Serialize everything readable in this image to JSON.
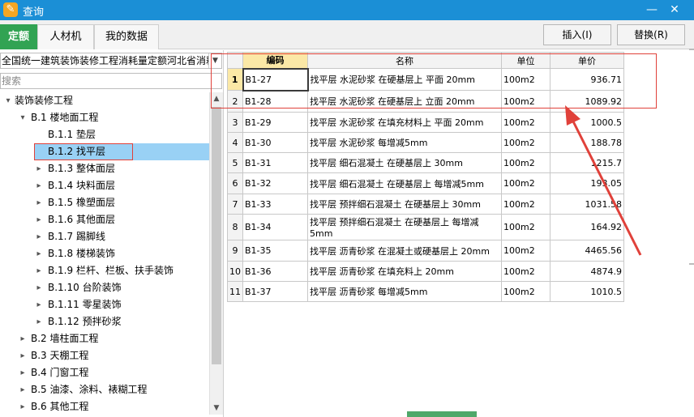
{
  "window": {
    "title": "查询",
    "minimize": "—",
    "close": "✕",
    "app_icon": "edit-icon"
  },
  "tabs": [
    "定额",
    "人材机",
    "我的数据"
  ],
  "actions": {
    "insert": "插入(I)",
    "replace": "替换(R)"
  },
  "left": {
    "combo_value": "全国统一建筑装饰装修工程消耗量定额河北省消耗",
    "search_placeholder": "搜索",
    "tree": [
      {
        "level": 0,
        "arrow": "▾",
        "label": "装饰装修工程"
      },
      {
        "level": 1,
        "arrow": "▾",
        "label": "B.1 楼地面工程"
      },
      {
        "level": 2,
        "arrow": "",
        "label": "B.1.1 垫层"
      },
      {
        "level": 2,
        "arrow": "",
        "label": "B.1.2 找平层",
        "selected": true
      },
      {
        "level": 2,
        "arrow": "▸",
        "label": "B.1.3 整体面层"
      },
      {
        "level": 2,
        "arrow": "▸",
        "label": "B.1.4 块料面层"
      },
      {
        "level": 2,
        "arrow": "▸",
        "label": "B.1.5 橡塑面层"
      },
      {
        "level": 2,
        "arrow": "▸",
        "label": "B.1.6 其他面层"
      },
      {
        "level": 2,
        "arrow": "▸",
        "label": "B.1.7 踢脚线"
      },
      {
        "level": 2,
        "arrow": "▸",
        "label": "B.1.8 楼梯装饰"
      },
      {
        "level": 2,
        "arrow": "▸",
        "label": "B.1.9 栏杆、栏板、扶手装饰"
      },
      {
        "level": 2,
        "arrow": "▸",
        "label": "B.1.10 台阶装饰"
      },
      {
        "level": 2,
        "arrow": "▸",
        "label": "B.1.11 零星装饰"
      },
      {
        "level": 2,
        "arrow": "▸",
        "label": "B.1.12 预拌砂浆"
      },
      {
        "level": 1,
        "arrow": "▸",
        "label": "B.2 墙柱面工程"
      },
      {
        "level": 1,
        "arrow": "▸",
        "label": "B.3 天棚工程"
      },
      {
        "level": 1,
        "arrow": "▸",
        "label": "B.4 门窗工程"
      },
      {
        "level": 1,
        "arrow": "▸",
        "label": "B.5 油漆、涂料、裱糊工程"
      },
      {
        "level": 1,
        "arrow": "▸",
        "label": "B.6 其他工程"
      }
    ]
  },
  "grid": {
    "headers": [
      "",
      "编码",
      "名称",
      "单位",
      "单价"
    ],
    "rows": [
      {
        "n": "1",
        "code": "B1-27",
        "name": "找平层 水泥砂浆 在硬基层上 平面 20mm",
        "unit": "100m2",
        "price": "936.71"
      },
      {
        "n": "2",
        "code": "B1-28",
        "name": "找平层 水泥砂浆 在硬基层上 立面 20mm",
        "unit": "100m2",
        "price": "1089.92"
      },
      {
        "n": "3",
        "code": "B1-29",
        "name": "找平层 水泥砂浆 在填充材料上 平面 20mm",
        "unit": "100m2",
        "price": "1000.5"
      },
      {
        "n": "4",
        "code": "B1-30",
        "name": "找平层 水泥砂浆 每增减5mm",
        "unit": "100m2",
        "price": "188.78"
      },
      {
        "n": "5",
        "code": "B1-31",
        "name": "找平层 细石混凝土 在硬基层上 30mm",
        "unit": "100m2",
        "price": "1215.7"
      },
      {
        "n": "6",
        "code": "B1-32",
        "name": "找平层 细石混凝土 在硬基层上 每增减5mm",
        "unit": "100m2",
        "price": "193.05"
      },
      {
        "n": "7",
        "code": "B1-33",
        "name": "找平层 预拌细石混凝土 在硬基层上 30mm",
        "unit": "100m2",
        "price": "1031.58"
      },
      {
        "n": "8",
        "code": "B1-34",
        "name": "找平层 预拌细石混凝土 在硬基层上 每增减5mm",
        "unit": "100m2",
        "price": "164.92"
      },
      {
        "n": "9",
        "code": "B1-35",
        "name": "找平层 沥青砂浆 在混凝土或硬基层上 20mm",
        "unit": "100m2",
        "price": "4465.56"
      },
      {
        "n": "10",
        "code": "B1-36",
        "name": "找平层 沥青砂浆 在填充料上 20mm",
        "unit": "100m2",
        "price": "4874.9"
      },
      {
        "n": "11",
        "code": "B1-37",
        "name": "找平层 沥青砂浆 每增减5mm",
        "unit": "100m2",
        "price": "1010.5"
      }
    ]
  },
  "colors": {
    "titlebar": "#1b8fd6",
    "active_tab": "#31a353",
    "annotation": "#e0413a",
    "selection": "#99d1f5"
  }
}
